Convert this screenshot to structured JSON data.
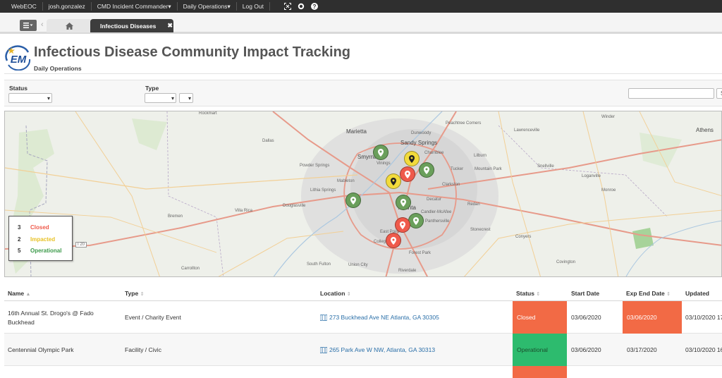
{
  "topnav": {
    "items": [
      "WebEOC",
      "josh.gonzalez",
      "CMD Incident Commander▾",
      "Daily Operations▾",
      "Log Out"
    ]
  },
  "tabs": {
    "active_label": "Infectious Diseases",
    "close_glyph": "✖"
  },
  "header": {
    "logo_text": "EM",
    "title": "Infectious Disease Community Impact Tracking",
    "subtitle": "Daily Operations"
  },
  "filters": {
    "status_label": "Status",
    "type_label": "Type",
    "search_button": "S"
  },
  "map": {
    "labels": {
      "rockmart": "Rockmart",
      "marietta": "Marietta",
      "dunwoody": "Dunwoody",
      "peachtree_corners": "Peachtree Corners",
      "sandy_springs": "Sandy Springs",
      "lawrenceville": "Lawrenceville",
      "winder": "Winder",
      "dallas": "Dallas",
      "smyrna": "Smyrna",
      "vinings": "Vinings",
      "chamblee": "Chamblee",
      "lilburn": "Lilburn",
      "snellville": "Snellville",
      "powder_springs": "Powder Springs",
      "tucker": "Tucker",
      "mountain_park": "Mountain Park",
      "loganville": "Loganville",
      "mableton": "Mableton",
      "clarkston": "Clarkston",
      "lithia_springs": "Lithia Springs",
      "monroe": "Monroe",
      "douglasville": "Douglasville",
      "decatur": "Decatur",
      "redan": "Redan",
      "atlanta": "Atlanta",
      "villa_rica": "Villa Rica",
      "bremen": "Bremen",
      "candler_mcafee": "Candler-McAfee",
      "panthersville": "Panthersville",
      "stonecrest": "Stonecrest",
      "conyers": "Conyers",
      "east_point": "East Point",
      "college_park": "College Park",
      "forest_park": "Forest Park",
      "carrollton": "Carrollton",
      "south_fulton": "South Fulton",
      "union_city": "Union City",
      "riverdale": "Riverdale",
      "covington": "Covington",
      "athens": "Athens",
      "i20": "I 20"
    },
    "legend": [
      {
        "count": "3",
        "label": "Closed",
        "color": "#ef5a4b"
      },
      {
        "count": "2",
        "label": "Impacted",
        "color": "#e8c228"
      },
      {
        "count": "5",
        "label": "Operational",
        "color": "#3c9a4a"
      }
    ],
    "pin_colors": {
      "green": "#6a9f5b",
      "red": "#ef5a4b",
      "yellow": "#f2db3c"
    }
  },
  "table": {
    "columns": {
      "name": "Name",
      "type": "Type",
      "location": "Location",
      "status": "Status",
      "start_date": "Start Date",
      "exp_end_date": "Exp End Date",
      "updated": "Updated"
    },
    "rows": [
      {
        "name_line1": "16th Annual St. Drogo's @ Fado",
        "name_line2": "Buckhead",
        "type": "Event  / Charity Event",
        "location": "273 Buckhead Ave NE Atlanta, GA 30305",
        "status": "Closed",
        "status_color": "#f26a45",
        "start_date": "03/06/2020",
        "exp_end_date": "03/06/2020",
        "exp_color": "#f26a45",
        "updated": "03/10/2020 17"
      },
      {
        "name_line1": "Centennial Olympic Park",
        "name_line2": "",
        "type": "Facility  / Civic",
        "location": "265 Park Ave W NW, Atlanta, GA 30313",
        "status": "Operational",
        "status_color": "#2dbb6e",
        "start_date": "03/06/2020",
        "exp_end_date": "03/17/2020",
        "exp_color": "",
        "updated": "03/10/2020 16"
      }
    ],
    "partial_row_status_color": "#f26a45"
  }
}
